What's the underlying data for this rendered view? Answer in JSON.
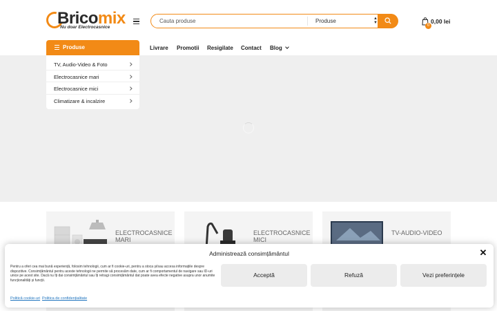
{
  "header": {
    "logo": {
      "brand_part1": "Brico",
      "brand_part2": "mix",
      "tagline": "Nu doar Electrocasnice"
    },
    "search": {
      "placeholder": "Cauta produse",
      "category": "Produse"
    },
    "cart": {
      "count": "0",
      "total": "0,00 lei"
    }
  },
  "nav": {
    "categories_label": "Produse",
    "links": [
      "Livrare",
      "Promotii",
      "Resigilate",
      "Contact",
      "Blog"
    ]
  },
  "dropdown": {
    "items": [
      "TV, Audio-Video & Foto",
      "Electrocasnice mari",
      "Electrocasnice mici",
      "Climatizare & incalzire"
    ]
  },
  "categories": [
    {
      "title": "ELECTROCASNICE MARI"
    },
    {
      "title": "ELECTROCASNICE MICI"
    },
    {
      "title": "TV-AUDIO-VIDEO"
    }
  ],
  "cookie": {
    "title": "Administrează consimțământul",
    "text": "Pentru a oferi cea mai bună experiență, folosim tehnologii, cum ar fi cookie-uri, pentru a stoca și/sau accesa informațiile despre dispozitive. Consimțământul pentru aceste tehnologii ne permite să procesăm date, cum ar fi comportamentul de navigare sau ID-uri unice pe acest site. Dacă nu îți dai consimțământul sau îți retragi consimțământul dat poate avea efecte negative asupra unor anumite funcționalități și funcții.",
    "accept": "Acceptă",
    "refuse": "Refuză",
    "preferences": "Vezi preferințele",
    "cookie_policy": "Politică cookie-uri",
    "privacy_policy": "Politica de confidențialitate"
  },
  "colors": {
    "accent": "#f28a16",
    "hero_bg": "#efefef"
  }
}
